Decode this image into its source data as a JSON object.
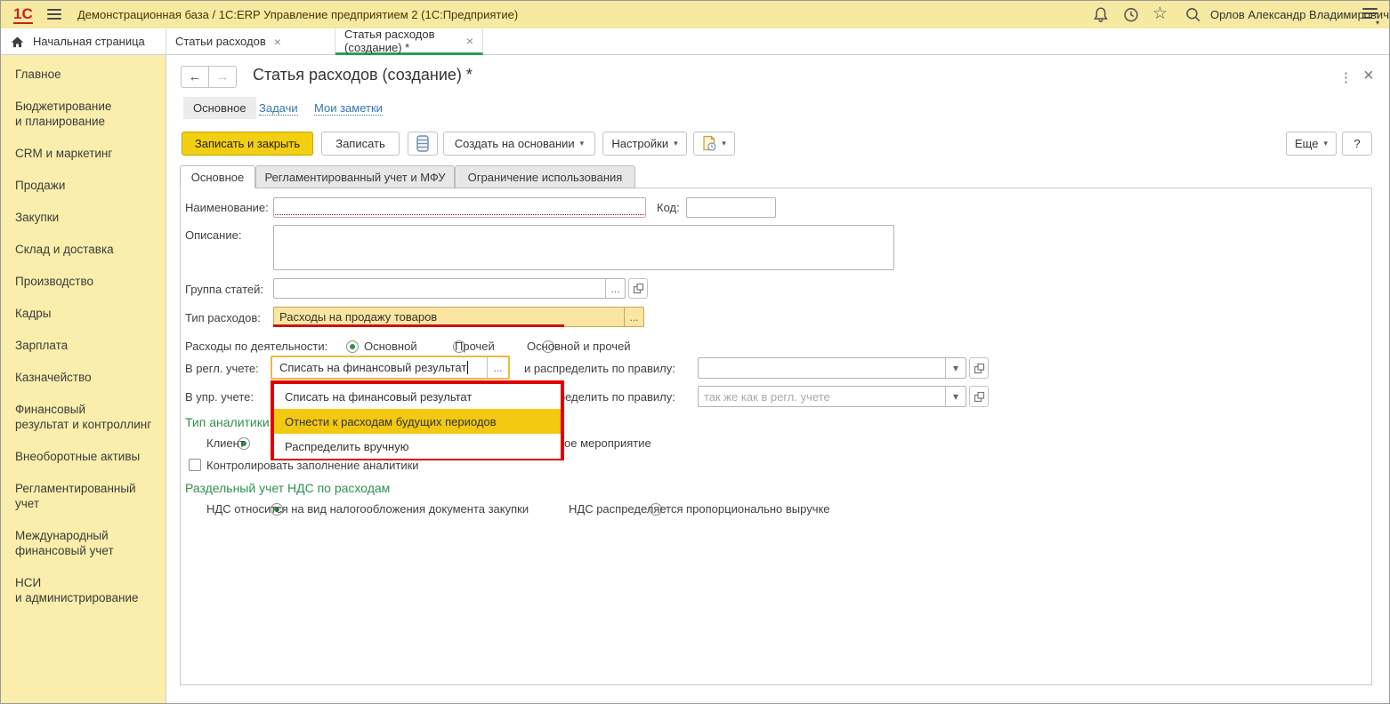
{
  "titlebar": {
    "logo_text": "1С",
    "title": "Демонстрационная база / 1С:ERP Управление предприятием 2  (1С:Предприятие)",
    "user_name": "Орлов Александр Владимирович"
  },
  "tabbar": {
    "home_label": "Начальная страница",
    "tabs": [
      {
        "label": "Статьи расходов"
      },
      {
        "label": "Статья расходов (создание) *",
        "active": true
      }
    ]
  },
  "sidebar": {
    "items": [
      {
        "label": "Главное"
      },
      {
        "label": [
          "Бюджетирование",
          "и планирование"
        ]
      },
      {
        "label": "CRM и маркетинг"
      },
      {
        "label": "Продажи"
      },
      {
        "label": "Закупки"
      },
      {
        "label": "Склад и доставка"
      },
      {
        "label": "Производство"
      },
      {
        "label": "Кадры"
      },
      {
        "label": "Зарплата"
      },
      {
        "label": "Казначейство"
      },
      {
        "label": [
          "Финансовый",
          "результат и контроллинг"
        ]
      },
      {
        "label": "Внеоборотные активы"
      },
      {
        "label": [
          "Регламентированный",
          "учет"
        ]
      },
      {
        "label": [
          "Международный",
          "финансовый учет"
        ]
      },
      {
        "label": [
          "НСИ",
          "и администрирование"
        ]
      }
    ]
  },
  "header": {
    "title": "Статья расходов (создание) *",
    "nav": {
      "main": "Основное",
      "tasks": "Задачи",
      "notes": "Мои заметки"
    }
  },
  "toolbar": {
    "save_close": "Записать и закрыть",
    "save": "Записать",
    "create_based_on": "Создать на основании",
    "settings": "Настройки",
    "more": "Еще",
    "help": "?"
  },
  "form_tabs": [
    {
      "label": "Основное",
      "active": true
    },
    {
      "label": "Регламентированный учет и МФУ"
    },
    {
      "label": "Ограничение использования"
    }
  ],
  "form": {
    "name": {
      "label": "Наименование:",
      "value": ""
    },
    "code": {
      "label": "Код:",
      "value": ""
    },
    "description": {
      "label": "Описание:",
      "value": ""
    },
    "group": {
      "label": "Группа статей:",
      "value": ""
    },
    "expense_type": {
      "label": "Тип расходов:",
      "value": "Расходы на продажу товаров"
    },
    "activity": {
      "label": "Расходы по деятельности:",
      "options": [
        {
          "label": "Основной",
          "selected": true
        },
        {
          "label": "Прочей",
          "selected": false
        },
        {
          "label": "Основной и прочей",
          "selected": false
        }
      ]
    },
    "reg_accounting": {
      "label": "В регл. учете:",
      "value": "Списать на финансовый результат"
    },
    "distribute_rule_label": "и распределить по правилу:",
    "reg_rule_value": "",
    "mgmt_accounting": {
      "label": "В упр. учете:"
    },
    "mgmt_rule_placeholder": "так же как в регл. учете",
    "dropdown": {
      "items": [
        {
          "label": "Списать на финансовый результат",
          "highlighted": false
        },
        {
          "label": "Отнести к расходам будущих периодов",
          "highlighted": true
        },
        {
          "label": "Распределить вручную",
          "highlighted": false
        }
      ]
    },
    "analytics_type_label": "Тип аналитики",
    "client_radio": {
      "label": "Клиент",
      "selected": true
    },
    "event_label_fragment": "ое мероприятие",
    "control_checkbox_label": "Контролировать заполнение аналитики",
    "vat_section": {
      "title": "Раздельный учет НДС по расходам",
      "options": [
        {
          "label": "НДС относится на вид налогообложения документа закупки",
          "selected": true
        },
        {
          "label": "НДС распределяется пропорционально выручке",
          "selected": false
        }
      ]
    }
  },
  "glyphs": {
    "close": "×",
    "caret": "▾",
    "dots": "...",
    "kebab": "⋮",
    "back": "←",
    "forward": "→",
    "star": "☆"
  },
  "colors": {
    "topbar_yellow": "#f6e9a1",
    "sidebar_yellow": "#f9eeab",
    "accent_green": "#2aa14e",
    "green_text": "#2e9150",
    "button_yellow": "#f3cf11",
    "highlight_yellow": "#f2c811",
    "alert_red": "#e00000",
    "required_red": "#b00020",
    "focus_orange": "#e7bb4a",
    "field_highlight": "#fbe5a0",
    "link_blue": "#3a74ad",
    "logo_red": "#cc2020"
  }
}
